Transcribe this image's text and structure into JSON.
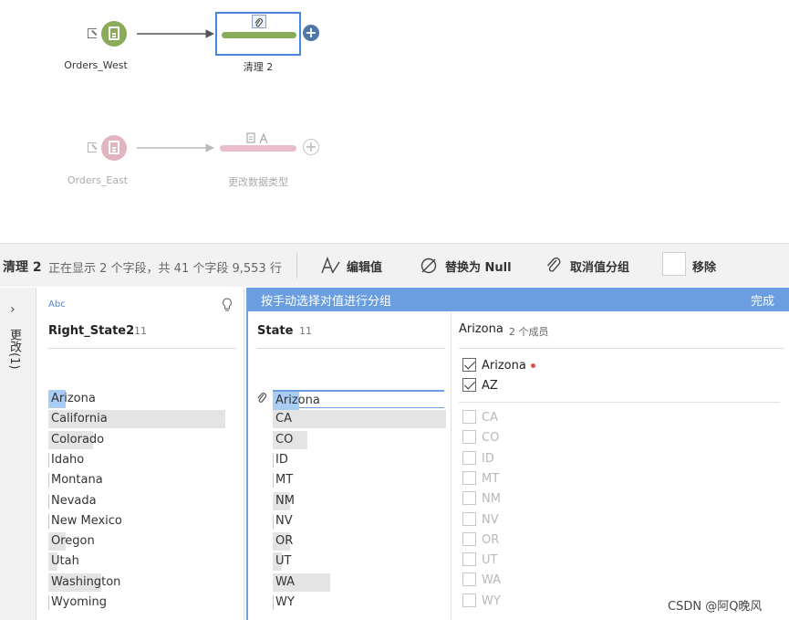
{
  "flow": {
    "nodes": [
      {
        "label": "Orders_West",
        "color": "#8aab5a"
      },
      {
        "label": "Orders_East",
        "color": "#c97a8e"
      }
    ],
    "steps": [
      {
        "label": "清理 2",
        "color": "#8aab5a",
        "selected": true
      },
      {
        "label": "更改数据类型",
        "color": "#d88aa0",
        "selected": false
      }
    ]
  },
  "toolbar": {
    "step_name": "清理 2",
    "summary": "正在显示 2 个字段，共 41 个字段  9,553 行",
    "edit_values": "编辑值",
    "replace_null": "替换为 Null",
    "ungroup": "取消值分组",
    "remove": "移除"
  },
  "changes_rail": {
    "label": "更改(1)"
  },
  "field_panel": {
    "type_badge": "Abc",
    "field_name": "Right_State2",
    "count": "11",
    "values": [
      {
        "text": "Arizona",
        "highlight": true,
        "fill": 0.1
      },
      {
        "text": "California",
        "fill": 1.0
      },
      {
        "text": "Colorado",
        "fill": 0.25
      },
      {
        "text": "Idaho",
        "fill": 0.0
      },
      {
        "text": "Montana",
        "fill": 0.0
      },
      {
        "text": "Nevada",
        "fill": 0.0
      },
      {
        "text": "New Mexico",
        "fill": 0.0
      },
      {
        "text": "Oregon",
        "fill": 0.1
      },
      {
        "text": "Utah",
        "fill": 0.05
      },
      {
        "text": "Washington",
        "fill": 0.3
      },
      {
        "text": "Wyoming",
        "fill": 0.0
      }
    ]
  },
  "group_panel": {
    "header_text": "按手动选择对值进行分组",
    "done_label": "完成",
    "state_field": "State",
    "state_count": "11",
    "state_values": [
      {
        "text": "Arizona",
        "highlight": true,
        "fill": 0.15,
        "grouped": true
      },
      {
        "text": "CA",
        "fill": 1.0
      },
      {
        "text": "CO",
        "fill": 0.2
      },
      {
        "text": "ID",
        "fill": 0.0
      },
      {
        "text": "MT",
        "fill": 0.0
      },
      {
        "text": "NM",
        "fill": 0.1
      },
      {
        "text": "NV",
        "fill": 0.0
      },
      {
        "text": "OR",
        "fill": 0.1
      },
      {
        "text": "UT",
        "fill": 0.05
      },
      {
        "text": "WA",
        "fill": 0.33
      },
      {
        "text": "WY",
        "fill": 0.0
      }
    ],
    "members_title": "Arizona",
    "members_count": "2 个成员",
    "members": [
      {
        "text": "Arizona",
        "checked": true,
        "dot": true
      },
      {
        "text": "AZ",
        "checked": true
      }
    ],
    "other_values": [
      "CA",
      "CO",
      "ID",
      "MT",
      "NM",
      "NV",
      "OR",
      "UT",
      "WA",
      "WY"
    ]
  },
  "watermark": "CSDN @阿Q晚风",
  "colors": {
    "accent": "#6a9ee0",
    "selected_border": "#4a86d8",
    "plus_active": "#4f77a8",
    "member_dot": "#d9534f"
  }
}
